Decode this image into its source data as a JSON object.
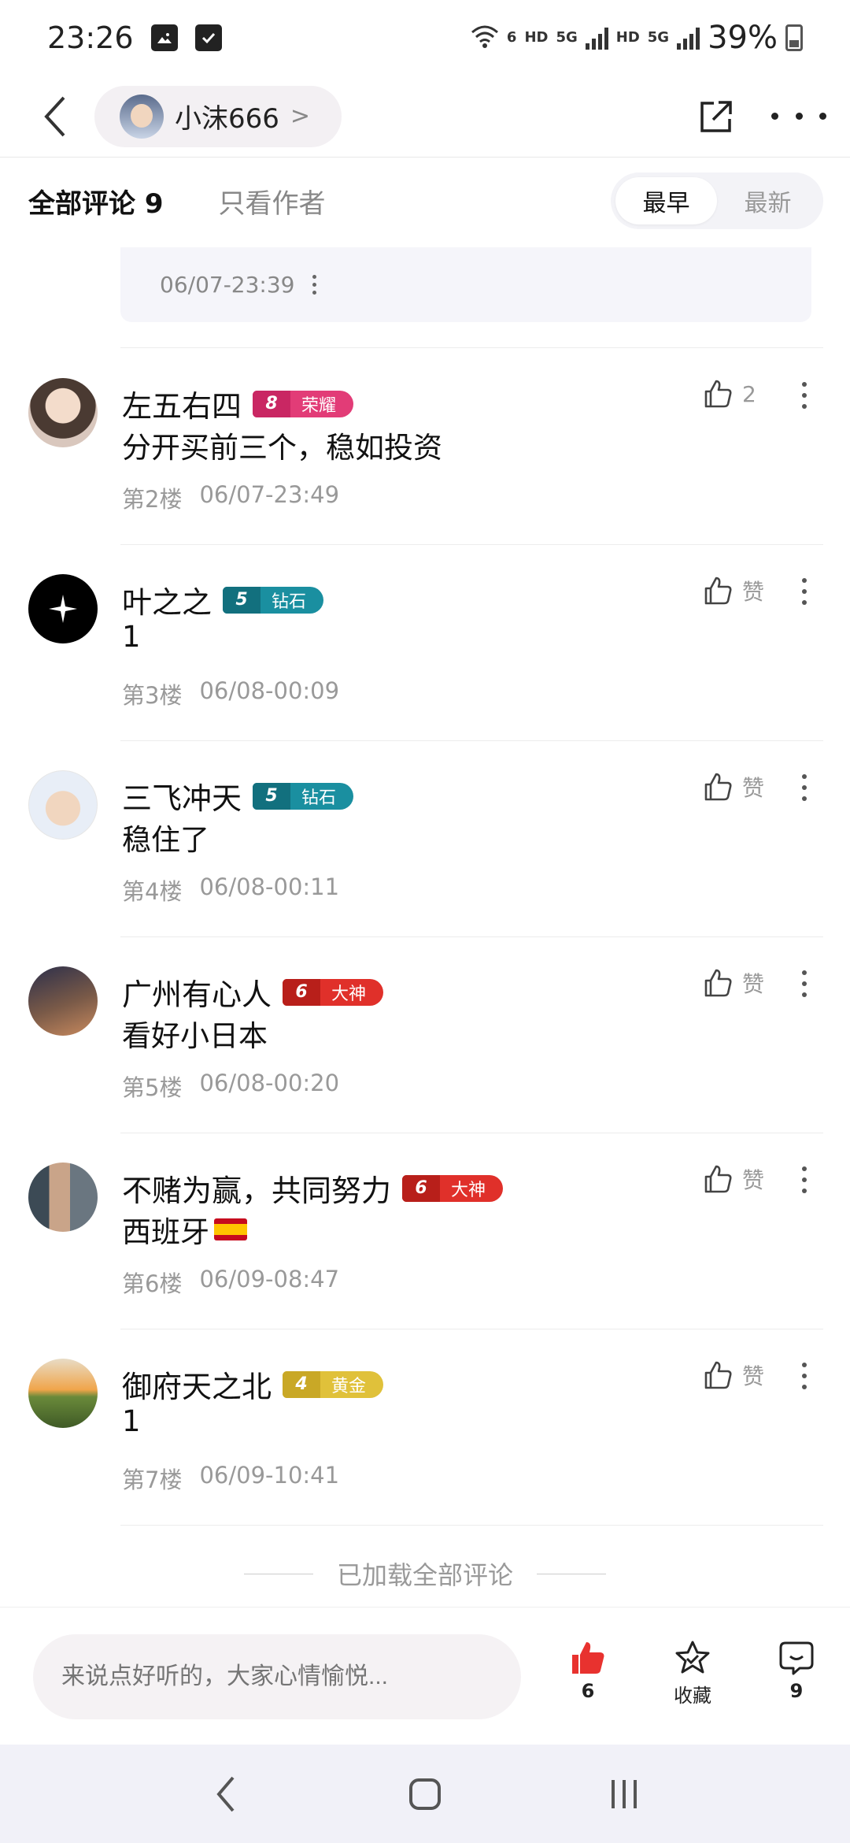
{
  "status_bar": {
    "time": "23:26",
    "wifi_badge": "6",
    "hd1": "HD",
    "net1": "5G",
    "hd2": "HD",
    "net2": "5G",
    "battery": "39%"
  },
  "header": {
    "username": "小沫666",
    "chevron": ">"
  },
  "filter": {
    "all_label": "全部评论 9",
    "author_only": "只看作者",
    "sort_earliest": "最早",
    "sort_latest": "最新"
  },
  "prev_reply": {
    "time": "06/07-23:39"
  },
  "comments": [
    {
      "name": "左五右四",
      "level": "8",
      "rank": "荣耀",
      "rank_color": "#e23c77",
      "text": "分开买前三个，稳如投资",
      "floor": "第2楼",
      "time": "06/07-23:49",
      "likes": "2"
    },
    {
      "name": "叶之之",
      "level": "5",
      "rank": "钻石",
      "rank_color": "#1a8fa0",
      "text": "1",
      "floor": "第3楼",
      "time": "06/08-00:09",
      "likes": "赞"
    },
    {
      "name": "三飞冲天",
      "level": "5",
      "rank": "钻石",
      "rank_color": "#1a8fa0",
      "text": "稳住了",
      "floor": "第4楼",
      "time": "06/08-00:11",
      "likes": "赞"
    },
    {
      "name": "广州有心人",
      "level": "6",
      "rank": "大神",
      "rank_color": "#e0302a",
      "text": "看好小日本",
      "floor": "第5楼",
      "time": "06/08-00:20",
      "likes": "赞"
    },
    {
      "name": "不赌为赢，共同努力",
      "level": "6",
      "rank": "大神",
      "rank_color": "#e0302a",
      "text": "西班牙",
      "floor": "第6楼",
      "time": "06/09-08:47",
      "likes": "赞"
    },
    {
      "name": "御府天之北",
      "level": "4",
      "rank": "黄金",
      "rank_color": "#e0c13a",
      "text": "1",
      "floor": "第7楼",
      "time": "06/09-10:41",
      "likes": "赞"
    }
  ],
  "end_note": "已加载全部评论",
  "bottom": {
    "input_placeholder": "来说点好听的，大家心情愉悦...",
    "like_count": "6",
    "favorite_label": "收藏",
    "comment_count": "9"
  },
  "colors": {
    "like_red": "#e8322f",
    "text_gray": "#999999"
  }
}
